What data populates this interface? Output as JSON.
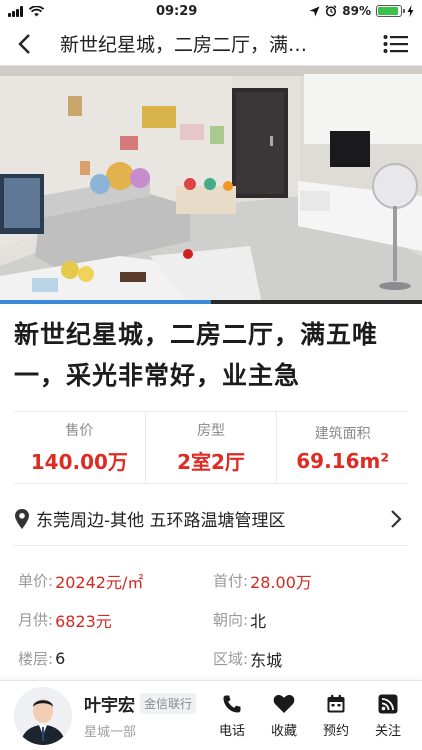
{
  "status_bar": {
    "time": "09:29",
    "battery_percent": "89%",
    "battery_level": 0.89
  },
  "nav": {
    "title": "新世纪星城，二房二厅，满…",
    "back_icon": "chevron-left-icon",
    "menu_icon": "menu-icon"
  },
  "photo": {
    "progress": 0.5
  },
  "listing": {
    "title": "新世纪星城，二房二厅，满五唯一，采光非常好，业主急"
  },
  "stats": [
    {
      "label": "售价",
      "value": "140.00万"
    },
    {
      "label": "房型",
      "value": "2室2厅"
    },
    {
      "label": "建筑面积",
      "value": "69.16m²"
    }
  ],
  "location": {
    "text": "东莞周边-其他 五环路温塘管理区",
    "icon": "location-pin-icon"
  },
  "details": {
    "unit_price_label": "单价:",
    "unit_price_value": "20242元/㎡",
    "down_payment_label": "首付:",
    "down_payment_value": "28.00万",
    "monthly_label": "月供:",
    "monthly_value": "6823元",
    "orientation_label": "朝向:",
    "orientation_value": "北",
    "floor_label": "楼层:",
    "floor_value": "6",
    "area_label": "区域:",
    "area_value": "东城"
  },
  "agent": {
    "name": "叶宇宏",
    "company": "金信联行",
    "department": "星城一部"
  },
  "actions": [
    {
      "label": "电话",
      "icon": "phone-icon"
    },
    {
      "label": "收藏",
      "icon": "heart-icon"
    },
    {
      "label": "预约",
      "icon": "calendar-icon"
    },
    {
      "label": "关注",
      "icon": "rss-icon"
    }
  ],
  "colors": {
    "price_red": "#e02a24",
    "detail_red": "#d22a22",
    "progress_blue": "#3a8ad8"
  }
}
